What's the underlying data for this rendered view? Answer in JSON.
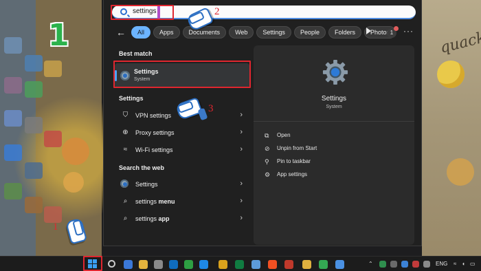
{
  "search": {
    "query": "settings"
  },
  "filters": {
    "back": "←",
    "chips": [
      "All",
      "Apps",
      "Documents",
      "Web",
      "Settings",
      "People",
      "Folders",
      "Photos"
    ],
    "badge": "1",
    "more": "···"
  },
  "results": {
    "best_match_heading": "Best match",
    "best_match": {
      "title": "Settings",
      "subtitle": "System"
    },
    "settings_heading": "Settings",
    "settings_items": [
      {
        "icon": "shield-icon",
        "label": "VPN settings"
      },
      {
        "icon": "globe-icon",
        "label": "Proxy settings"
      },
      {
        "icon": "wifi-icon",
        "label": "Wi-Fi settings"
      }
    ],
    "web_heading": "Search the web",
    "web_items": [
      {
        "icon": "settings-gear-icon",
        "label": "Settings"
      },
      {
        "icon": "search-icon",
        "prefix": "settings",
        "bold": " menu"
      },
      {
        "icon": "search-icon",
        "prefix": "settings",
        "bold": " app"
      }
    ]
  },
  "preview": {
    "title": "Settings",
    "subtitle": "System",
    "actions": [
      {
        "icon": "open-icon",
        "label": "Open"
      },
      {
        "icon": "unpin-icon",
        "label": "Unpin from Start"
      },
      {
        "icon": "pin-icon",
        "label": "Pin to taskbar"
      },
      {
        "icon": "gear-icon",
        "label": "App settings"
      }
    ]
  },
  "annotations": {
    "step_one_big": "1",
    "step_one": "1",
    "step_two": "2",
    "step_three": "3",
    "color": "#e0262f"
  },
  "desktop": {
    "art_text": "quack"
  },
  "taskbar": {
    "lang": "ENG"
  },
  "colors": {
    "accent": "#6cb4ff",
    "panel": "#202020",
    "preview": "#2b2b2b"
  }
}
